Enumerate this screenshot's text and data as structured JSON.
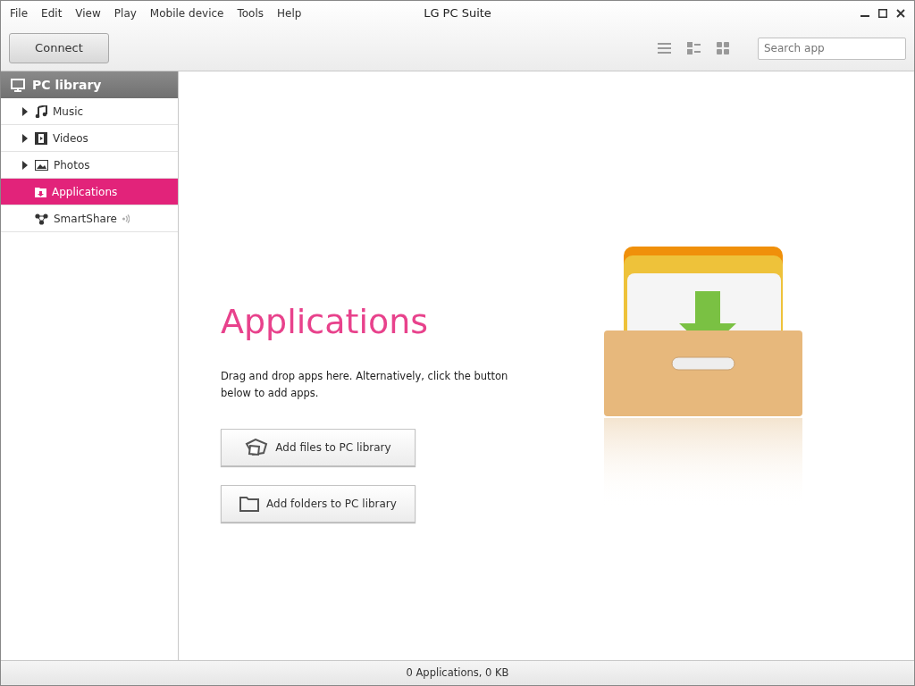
{
  "window": {
    "title": "LG PC Suite"
  },
  "menu": [
    "File",
    "Edit",
    "View",
    "Play",
    "Mobile device",
    "Tools",
    "Help"
  ],
  "toolbar": {
    "connect_button": "Connect",
    "search": {
      "placeholder": "Search app"
    }
  },
  "sidebar": {
    "header": "PC library",
    "items": [
      {
        "label": "Music",
        "expandable": true,
        "selected": false
      },
      {
        "label": "Videos",
        "expandable": true,
        "selected": false
      },
      {
        "label": "Photos",
        "expandable": true,
        "selected": false
      },
      {
        "label": "Applications",
        "expandable": false,
        "selected": true
      },
      {
        "label": "SmartShare",
        "expandable": false,
        "selected": false
      }
    ]
  },
  "main": {
    "title": "Applications",
    "description": "Drag and drop apps here. Alternatively, click the button below to add apps.",
    "buttons": [
      "Add files to PC library",
      "Add folders to PC library"
    ]
  },
  "status_bar": "0 Applications, 0 KB"
}
